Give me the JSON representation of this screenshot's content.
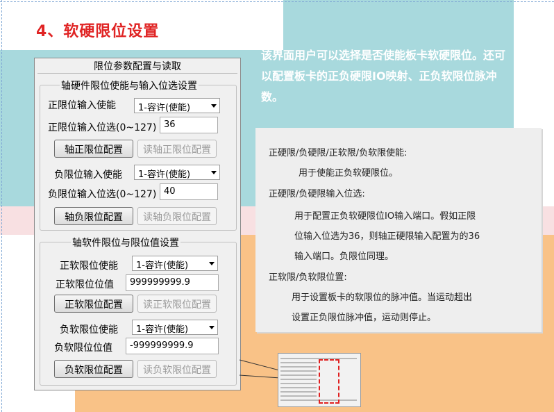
{
  "page": {
    "title": "4、软硬限位设置",
    "intro": "该界面用户可以选择是否使能板卡软硬限位。还可以配置板卡的正负硬限IO映射、正负软限位脉冲数。"
  },
  "notes": {
    "line1": "正硬限/负硬限/正软限/负软限使能:",
    "line2": "用于使能正负软硬限位。",
    "line3": "正硬限/负硬限输入位选:",
    "line4": "用于配置正负软硬限位IO输入端口。假如正限",
    "line5": "位输入位选为36，则轴正硬限输入配置为的36",
    "line6": "输入端口。负限位同理。",
    "line7": "正软限/负软限位置:",
    "line8": "用于设置板卡的软限位的脉冲值。当运动超出",
    "line9": "设置正负限位脉冲值，运动则停止。"
  },
  "dialog": {
    "title": "限位参数配置与读取",
    "hard_group": {
      "title": "轴硬件限位使能与输入位选设置",
      "pos_enable_label": "正限位输入使能",
      "pos_enable_value": "1-容许(使能)",
      "pos_select_label": "正限位输入位选(0~127)",
      "pos_select_value": "36",
      "pos_config_button": "轴正限位配置",
      "pos_read_button": "读轴正限位配置",
      "neg_enable_label": "负限位输入使能",
      "neg_enable_value": "1-容许(使能)",
      "neg_select_label": "负限位输入位选(0~127)",
      "neg_select_value": "40",
      "neg_config_button": "轴负限位配置",
      "neg_read_button": "读轴负限位配置"
    },
    "soft_group": {
      "title": "轴软件限位与限位值设置",
      "pos_enable_label": "正软限位使能",
      "pos_enable_value": "1-容许(使能)",
      "pos_value_label": "正软限位位值",
      "pos_value": "999999999.9",
      "pos_config_button": "正软限位配置",
      "pos_read_button": "读正软限位配置",
      "neg_enable_label": "负软限位使能",
      "neg_enable_value": "1-容许(使能)",
      "neg_value_label": "负软限位位值",
      "neg_value": "-999999999.9",
      "neg_config_button": "负软限位配置",
      "neg_read_button": "读负软限位配置"
    }
  },
  "colors": {
    "title_red": "#e02424",
    "teal_bg": "#a8d9dd",
    "orange_bg": "#f9c287",
    "pink_band": "#f8e0e2"
  }
}
